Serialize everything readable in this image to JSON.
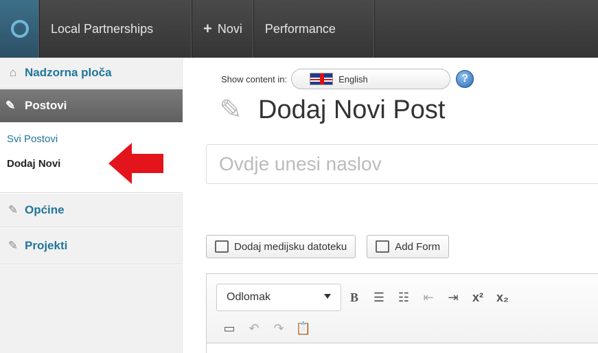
{
  "admin_bar": {
    "site_name": "Local Partnerships",
    "new_label": "Novi",
    "performance_label": "Performance"
  },
  "sidebar": {
    "dashboard": "Nadzorna ploča",
    "posts": "Postovi",
    "all_posts": "Svi Postovi",
    "add_new": "Dodaj Novi",
    "municipalities": "Općine",
    "projects": "Projekti"
  },
  "content": {
    "show_content_label": "Show content in:",
    "language": "English",
    "page_title": "Dodaj Novi Post",
    "title_placeholder": "Ovdje unesi naslov",
    "add_media_label": "Dodaj medijsku datoteku",
    "add_form_label": "Add Form",
    "format_select": "Odlomak"
  },
  "colors": {
    "admin_bar": "#3c3c3c",
    "sidebar_active": "#707070",
    "link": "#21759b",
    "arrow": "#e3141b"
  }
}
